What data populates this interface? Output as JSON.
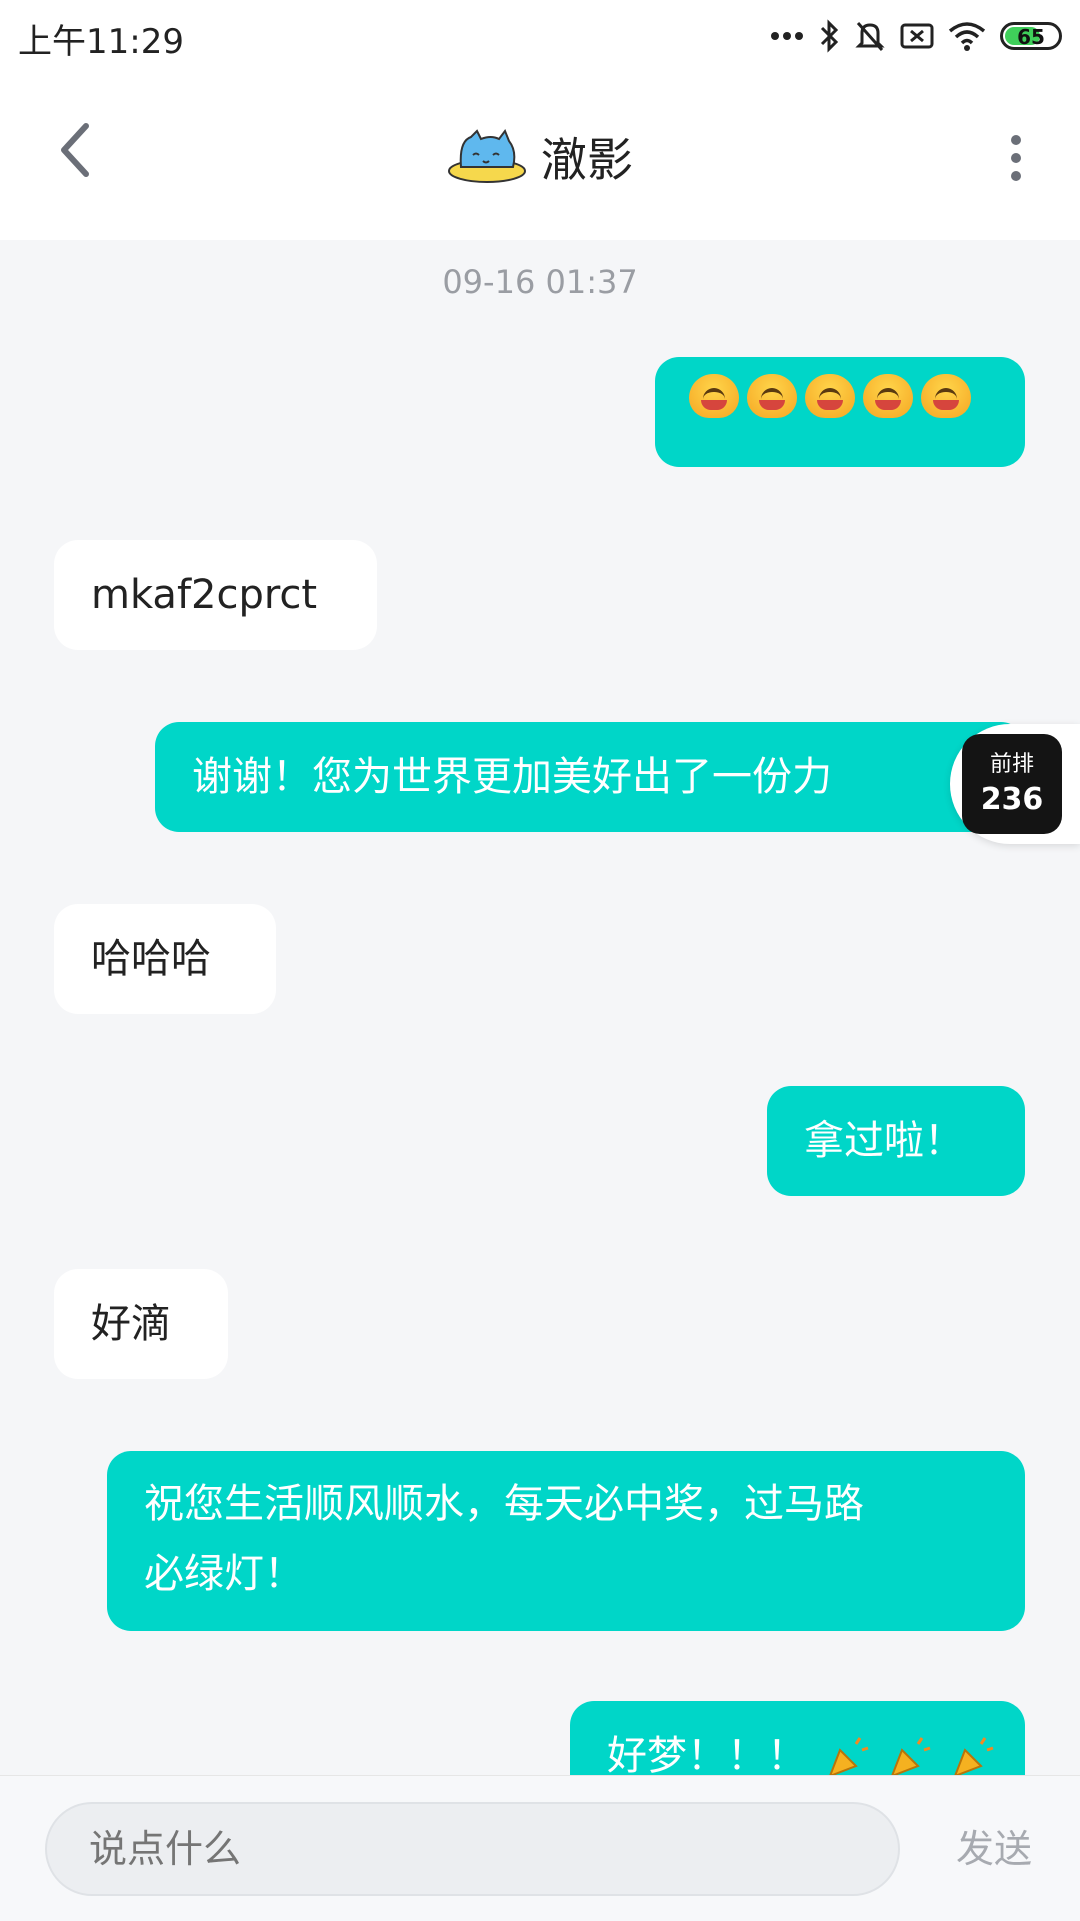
{
  "status_bar": {
    "time": "上午11:29",
    "battery_level": "65",
    "icons": [
      "more-dots-icon",
      "bluetooth-icon",
      "mute-bell-icon",
      "no-sim-icon",
      "wifi-icon",
      "battery-icon"
    ],
    "battery_color": "#3fcf5a"
  },
  "header": {
    "title": "澈影",
    "back_icon": "chevron-left-icon",
    "more_icon": "more-vertical-icon",
    "avatar_icon": "cat-avatar-icon"
  },
  "chat": {
    "timestamp": "09-16 01:37",
    "messages": [
      {
        "side": "out",
        "type": "emoji",
        "emoji": "laughing-face-emoji",
        "count": 5
      },
      {
        "side": "in",
        "text": "mkaf2cprct"
      },
      {
        "side": "out",
        "text": "谢谢！您为世界更加美好出了一份力"
      },
      {
        "side": "in",
        "text": "哈哈哈"
      },
      {
        "side": "out",
        "text": "拿过啦！"
      },
      {
        "side": "in",
        "text": "好滴"
      },
      {
        "side": "out",
        "line1": "祝您生活顺风顺水，每天必中奖，过马路",
        "line2": "必绿灯！"
      },
      {
        "side": "out",
        "text": "好梦！！！",
        "trailing_emoji": "party-popper-icon",
        "trailing_count": 3
      }
    ],
    "outgoing_color": "#00d6c8",
    "incoming_color": "#ffffff"
  },
  "floating_badge": {
    "label": "前排",
    "count": "236"
  },
  "input": {
    "placeholder": "说点什么",
    "send_label": "发送"
  }
}
